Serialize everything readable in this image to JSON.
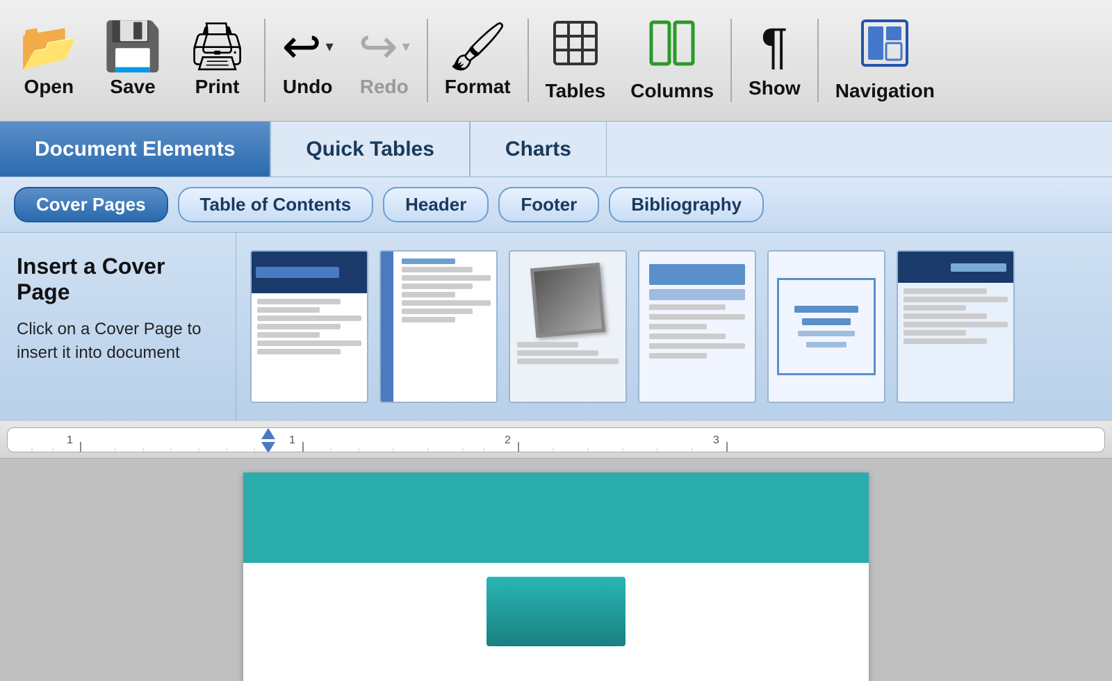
{
  "toolbar": {
    "items": [
      {
        "id": "open",
        "label": "Open",
        "icon": "📂"
      },
      {
        "id": "save",
        "label": "Save",
        "icon": "💾"
      },
      {
        "id": "print",
        "label": "Print",
        "icon": "🖨"
      },
      {
        "id": "undo",
        "label": "Undo",
        "icon": "↩",
        "has_arrow": true
      },
      {
        "id": "redo",
        "label": "Redo",
        "icon": "↪",
        "has_arrow": true,
        "dim": true
      },
      {
        "id": "format",
        "label": "Format",
        "icon": "🖌"
      },
      {
        "id": "tables",
        "label": "Tables",
        "icon": "⊞"
      },
      {
        "id": "columns",
        "label": "Columns",
        "icon": "▮▮"
      },
      {
        "id": "show",
        "label": "Show",
        "icon": "¶"
      },
      {
        "id": "navigation",
        "label": "Navigation",
        "icon": "▣"
      }
    ]
  },
  "ribbon_tabs": [
    {
      "id": "document-elements",
      "label": "Document Elements",
      "active": true
    },
    {
      "id": "quick-tables",
      "label": "Quick Tables",
      "active": false
    },
    {
      "id": "charts",
      "label": "Charts",
      "active": false
    }
  ],
  "section_tabs": [
    {
      "id": "cover-pages",
      "label": "Cover Pages",
      "active": true
    },
    {
      "id": "table-of-contents",
      "label": "Table of Contents",
      "active": false
    },
    {
      "id": "header",
      "label": "Header",
      "active": false
    },
    {
      "id": "footer",
      "label": "Footer",
      "active": false
    },
    {
      "id": "bibliography",
      "label": "Bibliography",
      "active": false
    }
  ],
  "left_panel": {
    "title": "Insert a Cover Page",
    "description": "Click on a Cover Page to insert it into document"
  },
  "ruler": {
    "numbers": [
      "1",
      "1",
      "2",
      "3"
    ]
  },
  "page": {
    "has_teal_header": true,
    "teal_color": "#2aacac"
  }
}
